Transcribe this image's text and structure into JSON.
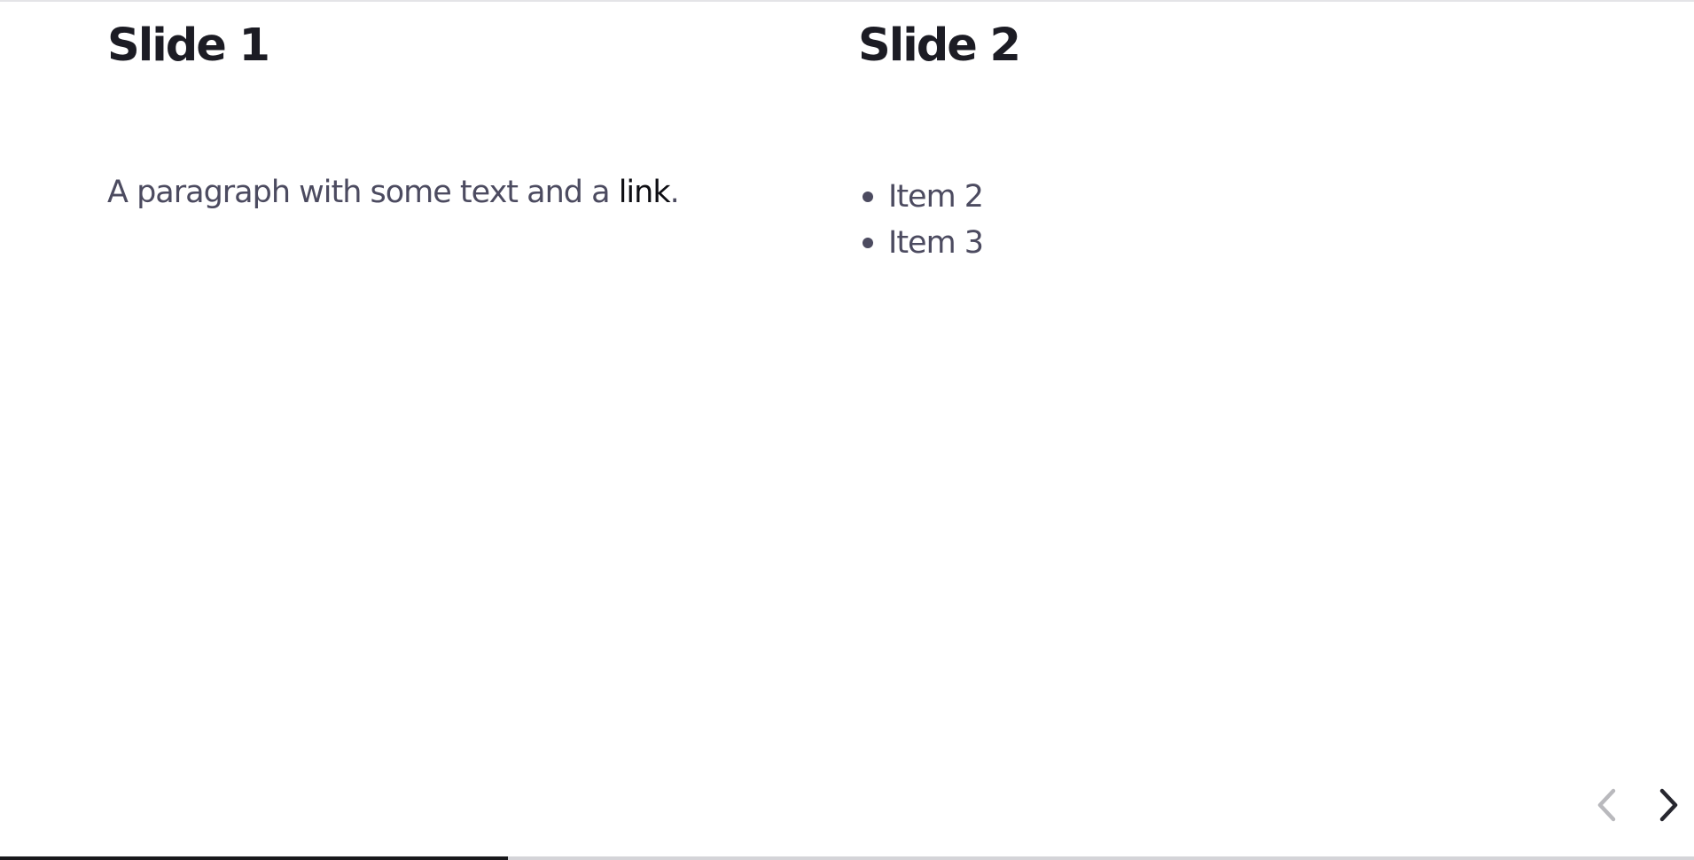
{
  "slides": [
    {
      "title": "Slide 1",
      "paragraph": {
        "before_link": "A paragraph with some text and a ",
        "link_text": "link",
        "after_link": "."
      }
    },
    {
      "title": "Slide 2",
      "list_items": [
        "Item 2",
        "Item 3"
      ]
    }
  ],
  "navigation": {
    "prev_icon": "chevron-left-icon",
    "next_icon": "chevron-right-icon",
    "prev_enabled": false,
    "next_enabled": true
  },
  "progress": {
    "fraction": 0.3
  },
  "colors": {
    "title": "#1c1c24",
    "body_text": "#4c4b60",
    "link": "#0e0e13",
    "progress_fill": "#18181b",
    "progress_track": "#d4d4d8",
    "nav_disabled": "#b9b9bd",
    "nav_enabled": "#27272f"
  }
}
